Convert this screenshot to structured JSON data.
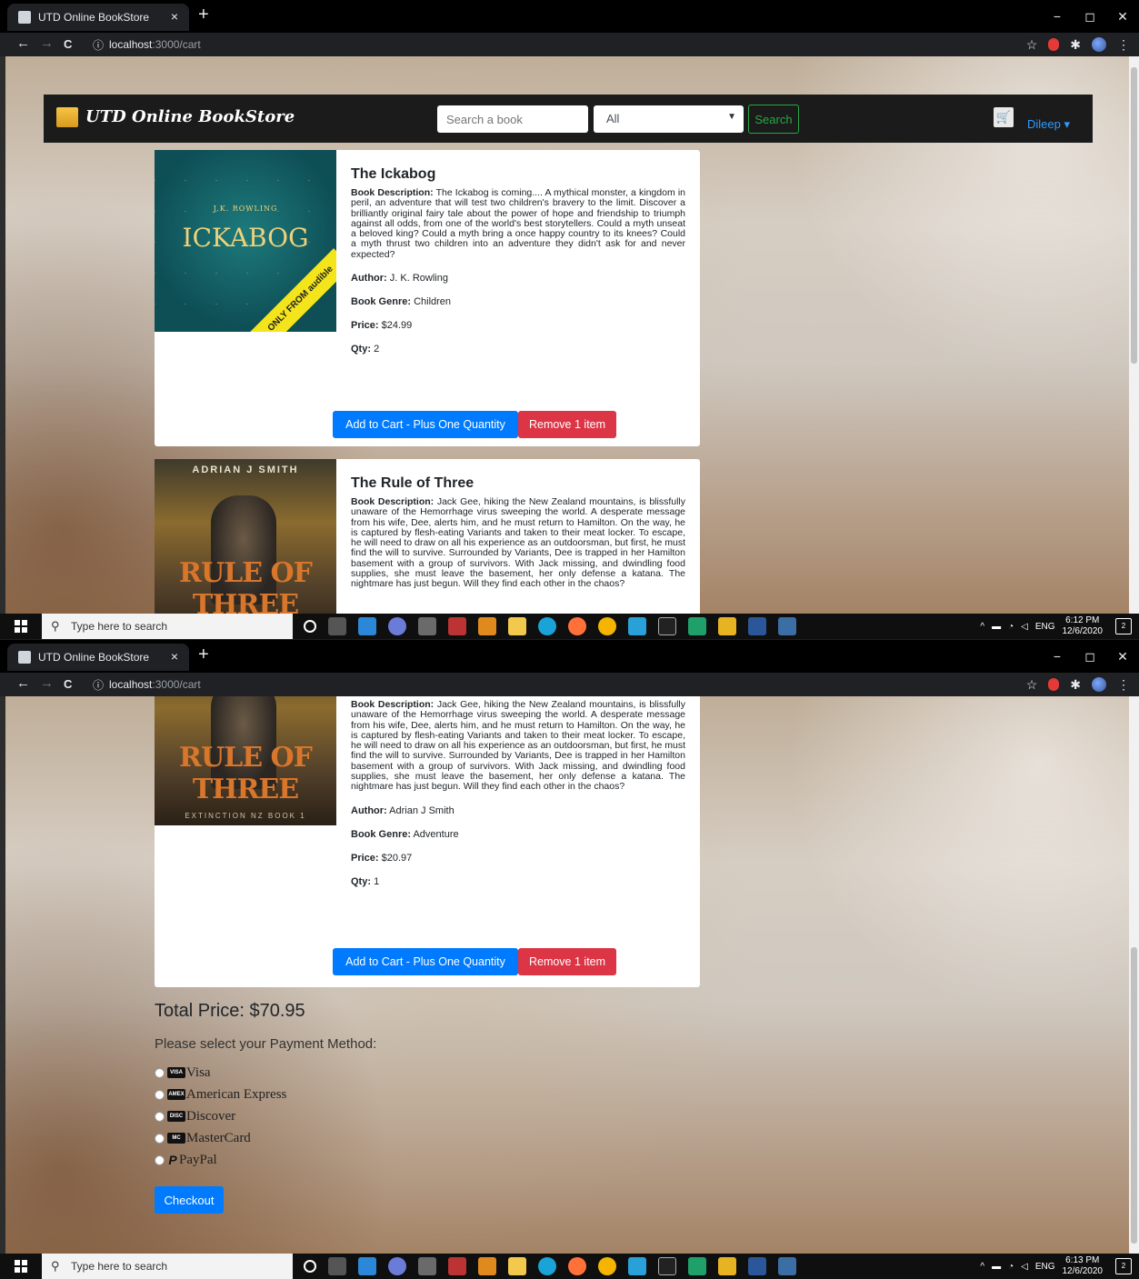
{
  "browser": {
    "tab_title": "UTD Online BookStore",
    "tab_close": "×",
    "new_tab": "+",
    "url_host": "localhost",
    "url_path": ":3000/cart",
    "nav_back": "←",
    "nav_forward": "→",
    "nav_reload": "C",
    "info_glyph": "ⓘ",
    "bookmark_star": "☆",
    "ext_puzzle": "✱",
    "menu_dots": "⋮",
    "win_min": "−",
    "win_max": "◻",
    "win_close": "✕"
  },
  "navbar": {
    "brand": "UTD Online BookStore",
    "search_placeholder": "Search a book",
    "category_value": "All",
    "search_button": "Search",
    "user": "Dileep ▾"
  },
  "books": [
    {
      "title": "The Ickabog",
      "cover_author": "J.K. ROWLING",
      "cover_title": "ICKABOG",
      "cover_band": "ONLY FROM audible",
      "description_label": "Book Description:",
      "description": "The Ickabog is coming.... A mythical monster, a kingdom in peril, an adventure that will test two children's bravery to the limit. Discover a brilliantly original fairy tale about the power of hope and friendship to triumph against all odds, from one of the world's best storytellers. Could a myth unseat a beloved king? Could a myth bring a once happy country to its knees? Could a myth thrust two children into an adventure they didn't ask for and never expected?",
      "author_label": "Author:",
      "author": "J. K. Rowling",
      "genre_label": "Book Genre:",
      "genre": "Children",
      "price_label": "Price:",
      "price": "$24.99",
      "qty_label": "Qty:",
      "qty": "2",
      "add_button": "Add to Cart - Plus One Quantity",
      "remove_button": "Remove 1 item"
    },
    {
      "title": "The Rule of Three",
      "cover_author": "ADRIAN J SMITH",
      "cover_title": "RULE OF THREE",
      "cover_sub": "EXTINCTION NZ BOOK 1",
      "description_label": "Book Description:",
      "description": "Jack Gee, hiking the New Zealand mountains, is blissfully unaware of the Hemorrhage virus sweeping the world. A desperate message from his wife, Dee, alerts him, and he must return to Hamilton. On the way, he is captured by flesh-eating Variants and taken to their meat locker. To escape, he will need to draw on all his experience as an outdoorsman, but first, he must find the will to survive. Surrounded by Variants, Dee is trapped in her Hamilton basement with a group of survivors. With Jack missing, and dwindling food supplies, she must leave the basement, her only defense a katana. The nightmare has just begun. Will they find each other in the chaos?",
      "author_label": "Author:",
      "author": "Adrian J Smith",
      "genre_label": "Book Genre:",
      "genre": "Adventure",
      "price_label": "Price:",
      "price": "$20.97",
      "qty_label": "Qty:",
      "qty": "1",
      "add_button": "Add to Cart - Plus One Quantity",
      "remove_button": "Remove 1 item"
    }
  ],
  "cart": {
    "total": "Total Price: $70.95",
    "payment_prompt": "Please select your Payment Method:",
    "payment_methods": [
      {
        "label": "Visa",
        "icon": "visa-icon",
        "badge": "VISA"
      },
      {
        "label": "American Express",
        "icon": "amex-icon",
        "badge": "AMEX"
      },
      {
        "label": "Discover",
        "icon": "discover-icon",
        "badge": "DISC"
      },
      {
        "label": "MasterCard",
        "icon": "mastercard-icon",
        "badge": "MC"
      },
      {
        "label": "PayPal",
        "icon": "paypal-icon",
        "badge": "P"
      }
    ],
    "checkout": "Checkout"
  },
  "taskbar": {
    "search_placeholder": "Type here to search",
    "language": "ENG",
    "shot1_time": "6:12 PM",
    "shot2_time": "6:13 PM",
    "date": "12/6/2020",
    "notifications": "2"
  },
  "colors": {
    "primary": "#007bff",
    "danger": "#dc3545",
    "success": "#28a745",
    "navbar": "#1b1b1b",
    "user_link": "#2f9bff"
  }
}
